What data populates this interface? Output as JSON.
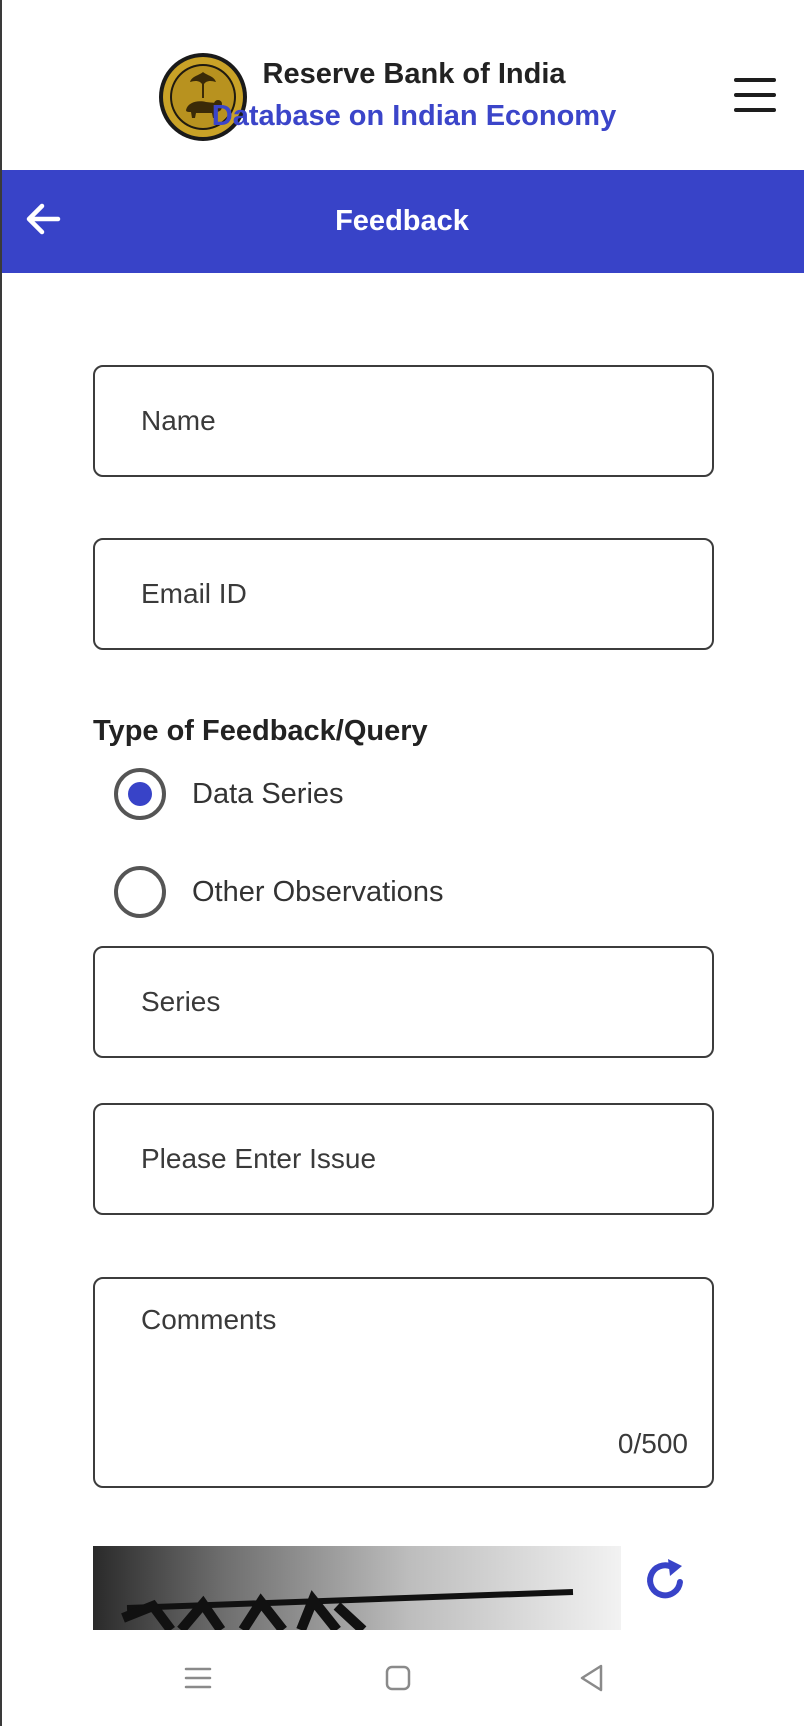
{
  "header": {
    "title": "Reserve Bank of India",
    "subtitle": "Database on Indian Economy",
    "logo_icon": "rbi-logo-icon",
    "menu_icon": "hamburger-menu-icon"
  },
  "appbar": {
    "title": "Feedback",
    "back_icon": "arrow-left-icon"
  },
  "form": {
    "name_placeholder": "Name",
    "email_placeholder": "Email ID",
    "feedback_type_label": "Type of Feedback/Query",
    "options": [
      {
        "label": "Data Series",
        "selected": true
      },
      {
        "label": "Other Observations",
        "selected": false
      }
    ],
    "series_placeholder": "Series",
    "issue_placeholder": "Please Enter Issue",
    "comments_placeholder": "Comments",
    "comments_counter": "0/500"
  },
  "captcha": {
    "refresh_icon": "refresh-icon"
  },
  "navbar": {
    "recents_icon": "recents-icon",
    "home_icon": "home-icon",
    "back_icon": "nav-back-icon"
  },
  "colors": {
    "accent": "#3843c8",
    "subtitle": "#3b45c9",
    "text": "#222222"
  }
}
